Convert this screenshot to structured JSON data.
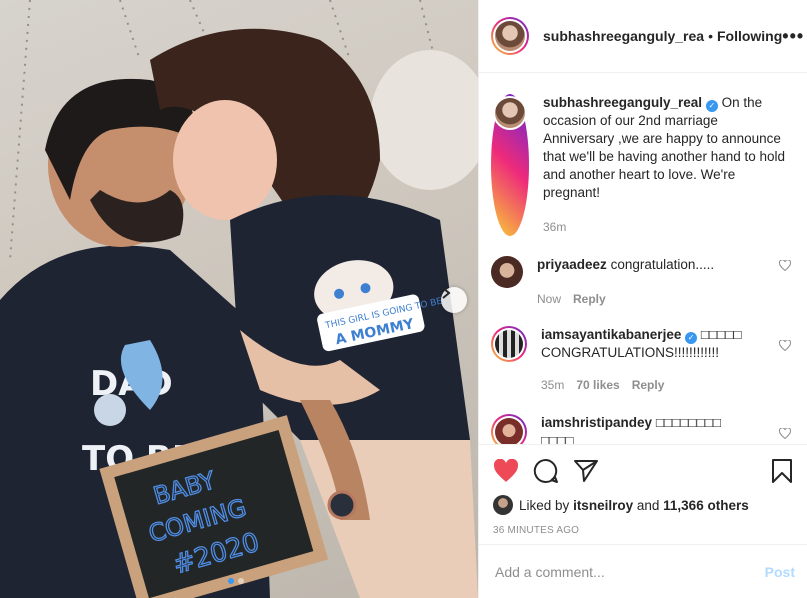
{
  "header": {
    "username": "subhashreeganguly_rea",
    "separator": "•",
    "follow_label": "Following",
    "more_label": "•••"
  },
  "caption": {
    "username": "subhashreeganguly_real",
    "verified": "✓",
    "text": "On the occasion of our 2nd marriage Anniversary ,we are happy to announce that we'll be having another hand to hold and another heart to love. We're pregnant!",
    "time": "36m"
  },
  "comments": [
    {
      "username": "priyaadeez",
      "verified": "",
      "text": "congratulation.....",
      "time": "Now",
      "likes": "",
      "reply": "Reply"
    },
    {
      "username": "iamsayantikabanerjee",
      "verified": "✓",
      "text": "□□□□□ CONGRATULATIONS!!!!!!!!!!!!",
      "time": "35m",
      "likes": "70 likes",
      "reply": "Reply"
    },
    {
      "username": "iamshristipandey",
      "verified": "",
      "text": "□□□□□□□□ □□□□",
      "time": "",
      "likes": "",
      "reply": ""
    }
  ],
  "photo_text": {
    "dad_shirt_top": "DAD",
    "dad_shirt_bottom": "TO BE",
    "mom_shirt_top": "THIS GIRL IS GOING TO BE",
    "mom_shirt_bottom": "A MOMMY",
    "board_line1": "BABY",
    "board_line2": "COMING",
    "board_line3": "#2020"
  },
  "actions": {
    "liked_by_prefix": "Liked by",
    "liked_by_user": "itsneilroy",
    "liked_by_suffix": "and",
    "others": "11,366 others",
    "timestamp": "36 MINUTES AGO"
  },
  "add_comment": {
    "placeholder": "Add a comment...",
    "post_label": "Post"
  },
  "carousel": {
    "slides": 2,
    "active": 1
  },
  "colors": {
    "accent": "#3897f0",
    "like": "#ed4956",
    "post_disabled": "#b3dbff"
  },
  "icons": [
    "chevron-right-icon",
    "heart-icon",
    "comment-icon",
    "share-icon",
    "bookmark-icon",
    "verified-icon",
    "more-icon"
  ]
}
